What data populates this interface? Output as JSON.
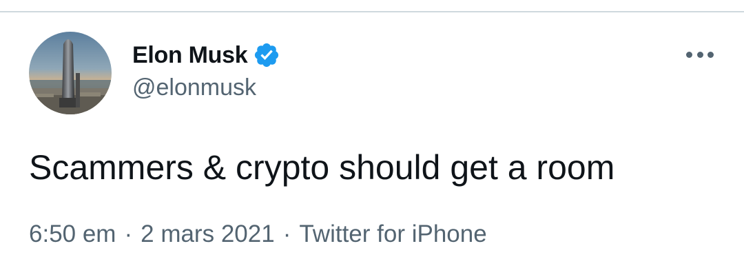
{
  "author": {
    "display_name": "Elon Musk",
    "handle": "@elonmusk",
    "verified": true,
    "avatar_icon": "starship-photo-avatar",
    "verified_color": "#1d9bf0"
  },
  "menu": {
    "more_icon": "more-horizontal-icon"
  },
  "tweet": {
    "text": "Scammers & crypto should get a room"
  },
  "meta": {
    "time": "6:50 em",
    "separator": "·",
    "date": "2 mars 2021",
    "source": "Twitter for iPhone"
  },
  "colors": {
    "primary_text": "#0f1419",
    "secondary_text": "#536471",
    "divider": "#cfd9de"
  }
}
